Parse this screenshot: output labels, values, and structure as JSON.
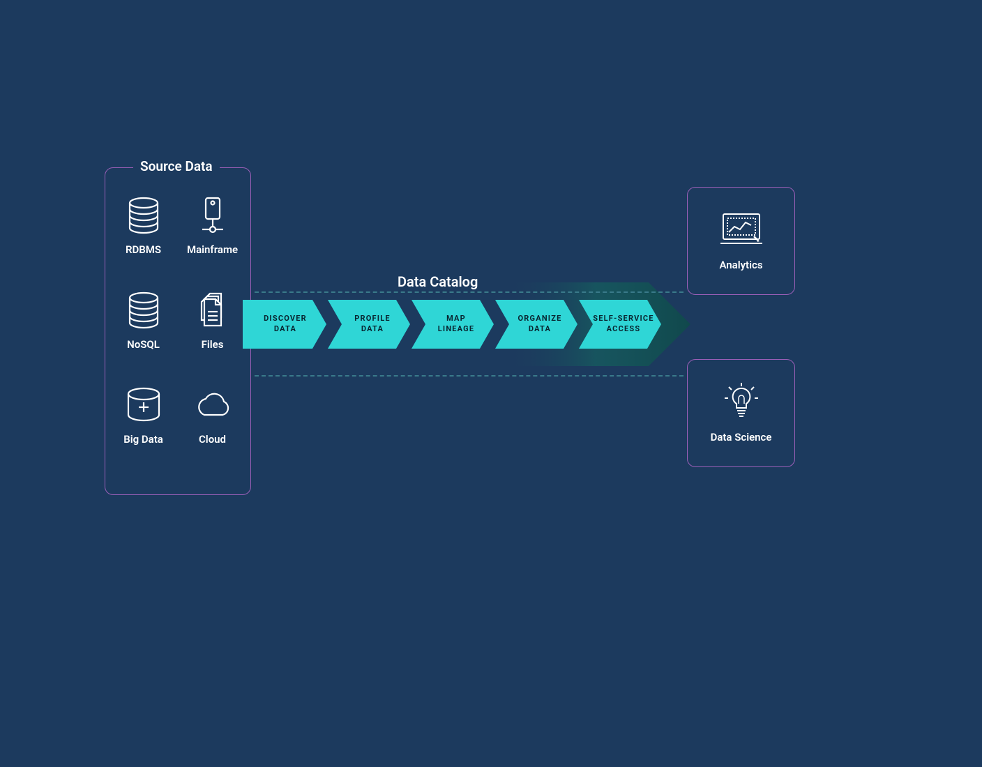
{
  "source": {
    "title": "Source Data",
    "items": [
      {
        "label": "RDBMS",
        "icon": "database-icon"
      },
      {
        "label": "Mainframe",
        "icon": "mainframe-icon"
      },
      {
        "label": "NoSQL",
        "icon": "database-icon"
      },
      {
        "label": "Files",
        "icon": "files-icon"
      },
      {
        "label": "Big Data",
        "icon": "bigdata-icon"
      },
      {
        "label": "Cloud",
        "icon": "cloud-icon"
      }
    ]
  },
  "catalog": {
    "title": "Data Catalog",
    "steps": [
      "DISCOVER\nDATA",
      "PROFILE\nDATA",
      "MAP\nLINEAGE",
      "ORGANIZE\nDATA",
      "SELF-SERVICE\nACCESS"
    ]
  },
  "outputs": {
    "analytics": {
      "label": "Analytics",
      "icon": "analytics-icon"
    },
    "datascience": {
      "label": "Data Science",
      "icon": "lightbulb-icon"
    }
  },
  "colors": {
    "bg": "#1c3a5e",
    "border": "#9b5fb8",
    "chevron": "#2fd6d6",
    "text": "#ffffff",
    "dash": "#3a7a8a"
  }
}
